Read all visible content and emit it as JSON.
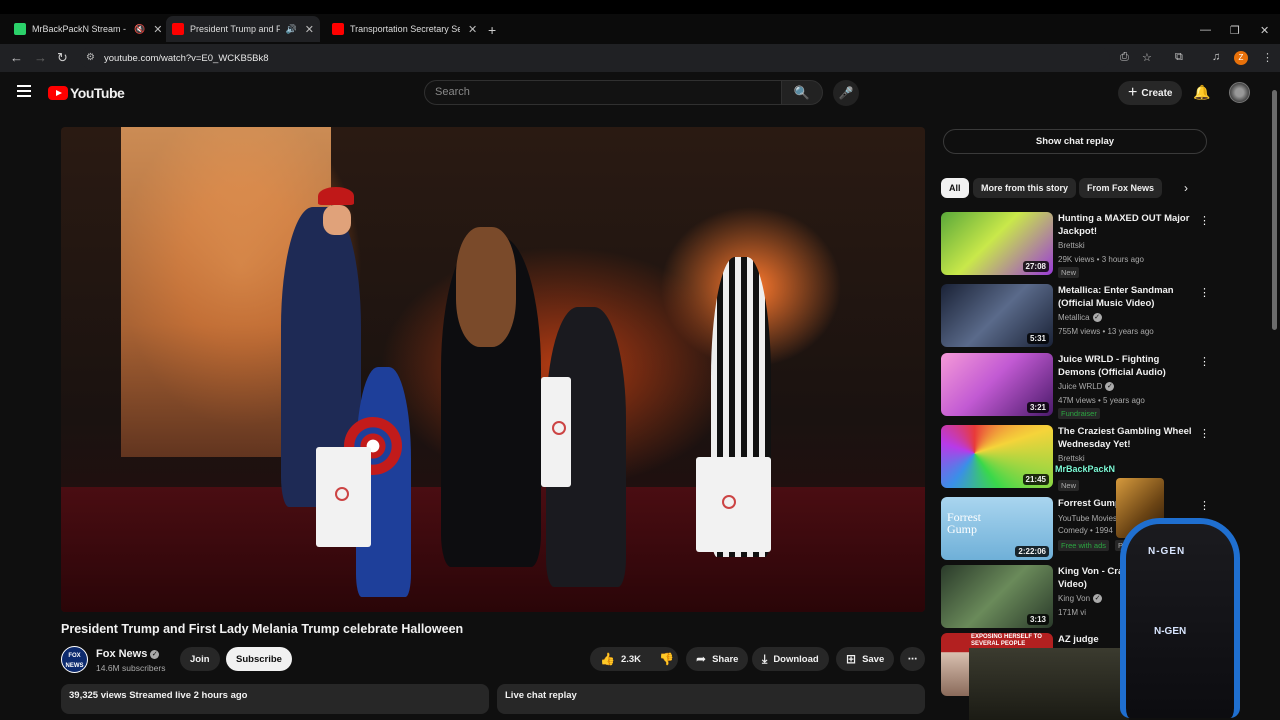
{
  "browser": {
    "tabs": [
      {
        "title": "MrBackPackN Stream - Wa",
        "favicon_color": "#2bd16a"
      },
      {
        "title": "President Trump and First L",
        "favicon_color": "#ff0000"
      },
      {
        "title": "Transportation Secretary Sean D",
        "favicon_color": "#ff0000"
      }
    ],
    "url": "youtube.com/watch?v=E0_WCKB5Bk8",
    "profile_initial": "Z"
  },
  "masthead": {
    "logo_text": "YouTube",
    "search_placeholder": "Search",
    "create_label": "Create"
  },
  "video": {
    "title": "President Trump and First Lady Melania Trump celebrate Halloween",
    "channel": "Fox News",
    "channel_logo_text": "FOX NEWS",
    "subscribers": "14.6M subscribers",
    "join_label": "Join",
    "subscribe_label": "Subscribe",
    "likes": "2.3K",
    "share_label": "Share",
    "download_label": "Download",
    "save_label": "Save",
    "views_line": "39,325 views  Streamed live 2 hours ago",
    "live_chat_replay": "Live chat replay"
  },
  "sidebar": {
    "show_chat_replay": "Show chat replay",
    "chips": [
      "All",
      "More from this story",
      "From Fox News"
    ],
    "recommendations": [
      {
        "title": "Hunting a MAXED OUT Major Jackpot!",
        "channel": "Brettski",
        "meta": "29K views • 3 hours ago",
        "badge": "New",
        "duration": "27:08",
        "thumb_color": "#5aa83a"
      },
      {
        "title": "Metallica: Enter Sandman (Official Music Video)",
        "channel": "Metallica",
        "meta": "755M views • 13 years ago",
        "badge": "",
        "duration": "5:31",
        "thumb_color": "#2e3a56"
      },
      {
        "title": "Juice WRLD - Fighting Demons (Official Audio)",
        "channel": "Juice WRLD",
        "meta": "47M views • 5 years ago",
        "badge": "Fundraiser",
        "duration": "3:21",
        "thumb_color": "#c25ad3"
      },
      {
        "title": "The Craziest Gambling Wheel Wednesday Yet!",
        "channel": "Brettski",
        "meta": "",
        "badge": "New",
        "duration": "21:45",
        "thumb_color": "#3f8fd8"
      },
      {
        "title": "Forrest Gump",
        "channel": "YouTube Movies",
        "meta": "Comedy • 1994",
        "badge": "Free with ads",
        "extra": "PG-13",
        "duration": "2:22:06",
        "thumb_color": "#8ec3e6",
        "thumb_text": "Forrest Gump"
      },
      {
        "title": "King Von - Crazy (Official Video)",
        "channel": "King Von",
        "meta": "171M vi",
        "badge": "",
        "duration": "3:13",
        "thumb_color": "#3e5a3a"
      },
      {
        "title": "AZ judge allegedly",
        "channel": "",
        "meta": "",
        "badge": "",
        "duration": "",
        "thumb_color": "#b32020",
        "thumb_text": "EXPOSING HERSELF TO SEVERAL PEOPLE"
      }
    ]
  },
  "overlay": {
    "streamer_name": "MrBackPackN",
    "chair_brand": "N-GEN"
  },
  "colors": {
    "background": "#0f0f0f",
    "brand_red": "#ff0000",
    "chip_bg": "#272727",
    "fundraiser_green": "#2ba640"
  }
}
